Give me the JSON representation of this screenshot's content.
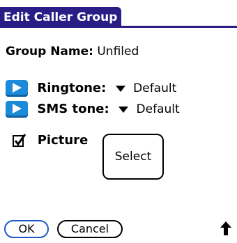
{
  "window": {
    "title": "Edit Caller Group"
  },
  "group": {
    "label": "Group Name:",
    "value": "Unfiled"
  },
  "ringtone": {
    "label": "Ringtone:",
    "value": "Default",
    "icon": "play-icon"
  },
  "sms_tone": {
    "label": "SMS tone:",
    "value": "Default",
    "icon": "play-icon"
  },
  "picture": {
    "label": "Picture",
    "checked": true,
    "select_label": "Select"
  },
  "buttons": {
    "ok": "OK",
    "cancel": "Cancel"
  },
  "icons": {
    "up": "up-arrow-icon",
    "dropdown": "triangle-down-icon"
  },
  "colors": {
    "title_bg": "#2b1d86",
    "play_bg": "#1b8ad8",
    "ok_border": "#1f56c9"
  }
}
